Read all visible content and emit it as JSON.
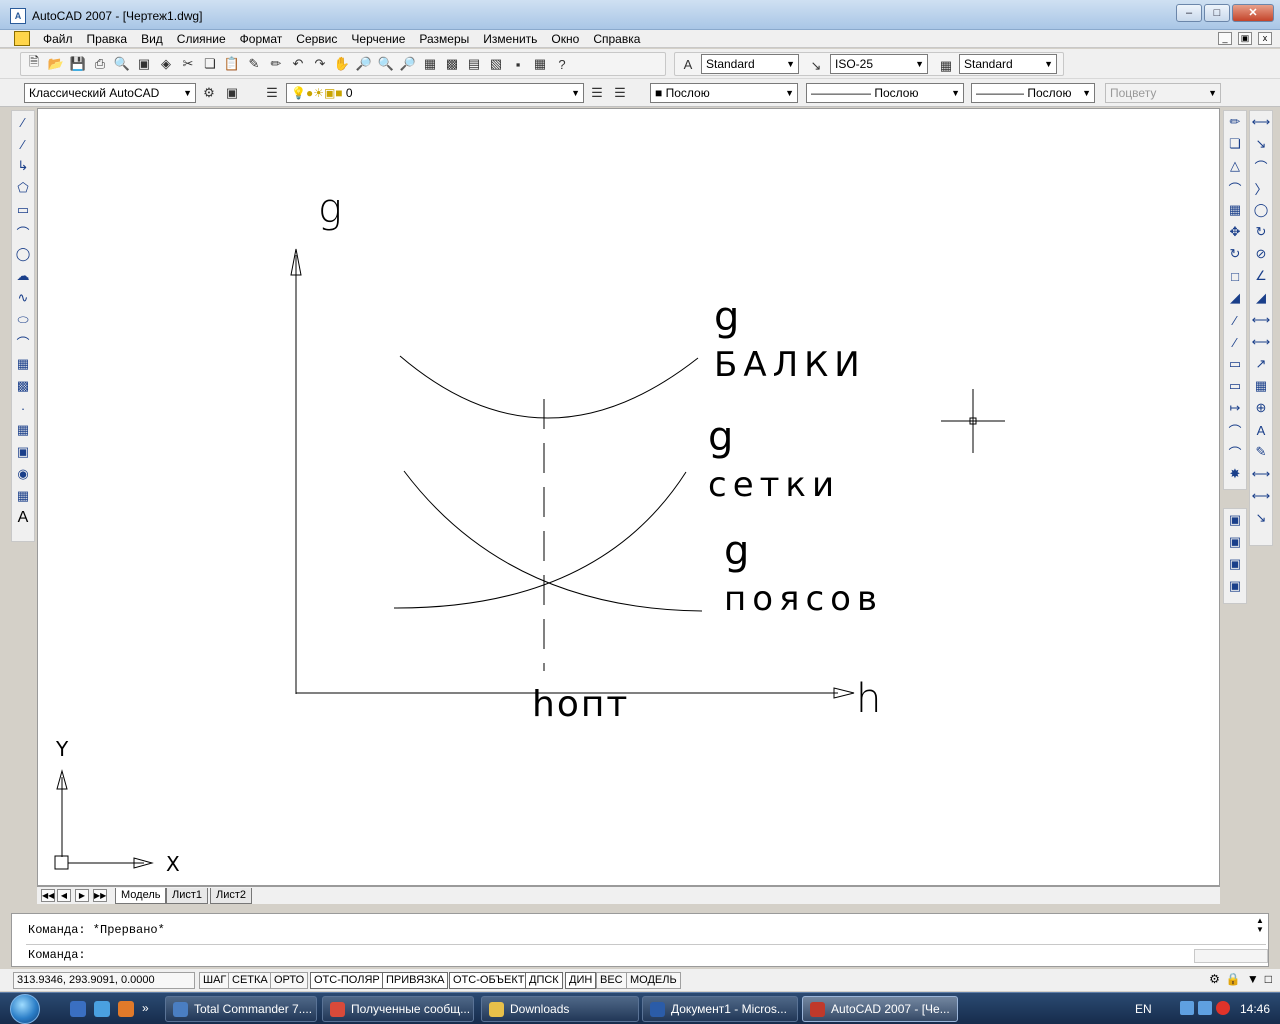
{
  "window": {
    "title": "AutoCAD 2007 - [Чертеж1.dwg]",
    "controls": [
      "minimize-icon",
      "maximize-icon",
      "close-icon"
    ]
  },
  "menu": {
    "items": [
      "Файл",
      "Правка",
      "Вид",
      "Слияние",
      "Формат",
      "Сервис",
      "Черчение",
      "Размеры",
      "Изменить",
      "Окно",
      "Справка"
    ]
  },
  "toolbar1": {
    "text_style": "Standard",
    "dim_style": "ISO-25",
    "table_style": "Standard"
  },
  "toolbar2": {
    "workspace": "Классический AutoCAD",
    "layer": "0",
    "color": "Послою",
    "linetype": "Послою",
    "lineweight": "Послою",
    "plotstyle": "Поцвету"
  },
  "drawing": {
    "y_axis_label": "g",
    "x_axis_label": "h",
    "x_marker_label": "hопт",
    "curves": [
      {
        "g": "g",
        "name": "балки"
      },
      {
        "g": "g",
        "name": "сетки"
      },
      {
        "g": "g",
        "name": "поясов"
      }
    ],
    "ucs_x": "X",
    "ucs_y": "Y"
  },
  "layout_tabs": [
    "Модель",
    "Лист1",
    "Лист2"
  ],
  "command": {
    "history": "Команда: *Прервано*",
    "prompt": "Команда:"
  },
  "status": {
    "coords": "313.9346, 293.9091, 0.0000",
    "buttons": [
      "ШАГ",
      "СЕТКА",
      "ОРТО",
      "ОТС-ПОЛЯР",
      "ПРИВЯЗКА",
      "ОТС-ОБЪЕКТ",
      "ДПСК",
      "ДИН",
      "ВЕС",
      "МОДЕЛЬ"
    ]
  },
  "taskbar": {
    "tasks": [
      {
        "label": "Total Commander 7....",
        "icon": "total-commander-icon",
        "color": "#4a7ec2"
      },
      {
        "label": "Полученные сообщ...",
        "icon": "chrome-icon",
        "color": "#d94a3a"
      },
      {
        "label": "Downloads",
        "icon": "folder-icon",
        "color": "#e8c04a"
      },
      {
        "label": "Документ1 - Micros...",
        "icon": "word-icon",
        "color": "#2b5ca8"
      },
      {
        "label": "AutoCAD 2007 - [Че...",
        "icon": "autocad-icon",
        "color": "#c0392b"
      }
    ],
    "language": "EN",
    "clock": "14:46"
  }
}
